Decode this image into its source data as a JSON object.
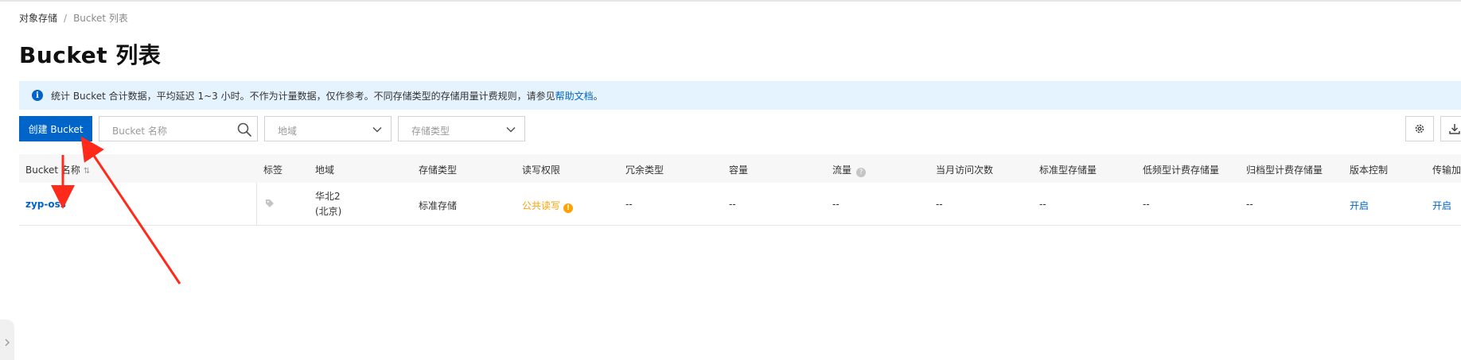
{
  "breadcrumb": {
    "root": "对象存储",
    "separator": "/",
    "current": "Bucket 列表"
  },
  "page_title": "Bucket 列表",
  "notice": {
    "icon": "info-icon",
    "text": "统计 Bucket 合计数据，平均延迟 1~3 小时。不作为计量数据，仅作参考。不同存储类型的存储用量计费规则，请参见",
    "link": "帮助文档",
    "suffix": "。"
  },
  "toolbar": {
    "create_label": "创建 Bucket",
    "search_placeholder": "Bucket 名称",
    "region_placeholder": "地域",
    "storage_placeholder": "存储类型"
  },
  "table": {
    "columns": [
      "Bucket 名称",
      "标签",
      "地域",
      "存储类型",
      "读写权限",
      "冗余类型",
      "容量",
      "流量",
      "当月访问次数",
      "标准型存储量",
      "低频型计费存储量",
      "归档型计费存储量",
      "版本控制",
      "传输加"
    ],
    "rows": [
      {
        "name": "zyp-oss",
        "region_line1": "华北2",
        "region_line2": "(北京)",
        "storage": "标准存储",
        "permission": "公共读写",
        "redundancy": "--",
        "capacity": "--",
        "traffic": "--",
        "monthly_visits": "--",
        "standard_storage": "--",
        "ia_storage": "--",
        "archive_storage": "--",
        "versioning": "开启",
        "transfer_accel": "开启"
      }
    ]
  },
  "colors": {
    "primary": "#0064c8",
    "notice_bg": "#e5f3ff",
    "warning": "#ffa003",
    "annotation_red": "#ff2a1a"
  }
}
